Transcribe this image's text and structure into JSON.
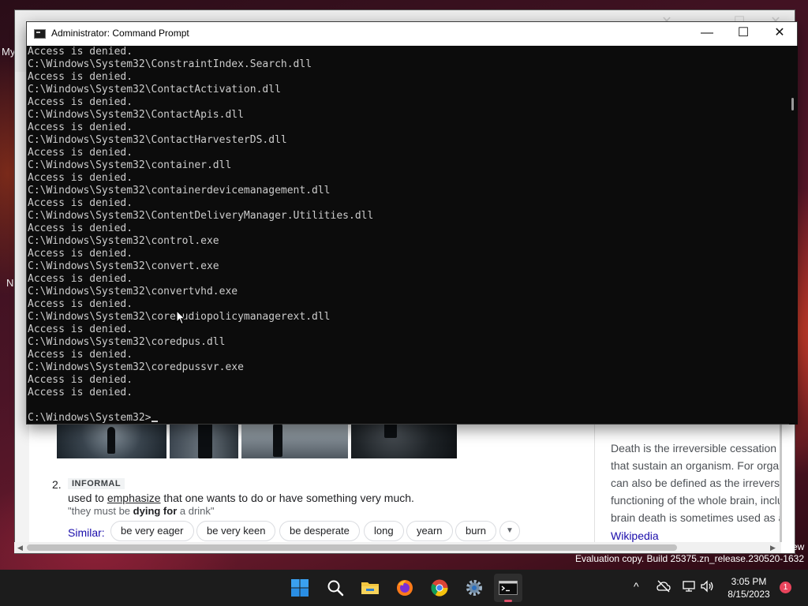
{
  "desktop": {
    "edge_labels": [
      "My",
      "N"
    ]
  },
  "browser": {
    "definition": {
      "number": "2.",
      "tag": "INFORMAL",
      "text_before": "used to ",
      "text_link": "emphasize",
      "text_after": " that one wants to do or have something very much.",
      "example_before": "\"they must be ",
      "example_bold": "dying for",
      "example_after": " a drink\"",
      "similar_label": "Similar:",
      "similar_chips": [
        "be very eager",
        "be very keen",
        "be desperate",
        "long",
        "yearn",
        "burn"
      ]
    },
    "knowledge_panel": {
      "lines": [
        "Death is the irreversible cessation",
        "that sustain an organism. For organ",
        "can also be defined as the irrevers",
        "functioning of the whole brain, inclu",
        "brain death is sometimes used as a"
      ],
      "source_link": "Wikipedia"
    },
    "edge_text": "ew"
  },
  "cmd": {
    "title": "Administrator: Command Prompt",
    "minimize_glyph": "—",
    "maximize_glyph": "☐",
    "close_glyph": "✕",
    "lines": [
      "Access is denied.",
      "C:\\Windows\\System32\\ConstraintIndex.Search.dll",
      "Access is denied.",
      "C:\\Windows\\System32\\ContactActivation.dll",
      "Access is denied.",
      "C:\\Windows\\System32\\ContactApis.dll",
      "Access is denied.",
      "C:\\Windows\\System32\\ContactHarvesterDS.dll",
      "Access is denied.",
      "C:\\Windows\\System32\\container.dll",
      "Access is denied.",
      "C:\\Windows\\System32\\containerdevicemanagement.dll",
      "Access is denied.",
      "C:\\Windows\\System32\\ContentDeliveryManager.Utilities.dll",
      "Access is denied.",
      "C:\\Windows\\System32\\control.exe",
      "Access is denied.",
      "C:\\Windows\\System32\\convert.exe",
      "Access is denied.",
      "C:\\Windows\\System32\\convertvhd.exe",
      "Access is denied.",
      "C:\\Windows\\System32\\coreaudiopolicymanagerext.dll",
      "Access is denied.",
      "C:\\Windows\\System32\\coredpus.dll",
      "Access is denied.",
      "C:\\Windows\\System32\\coredpussvr.exe",
      "Access is denied.",
      "Access is denied.",
      ""
    ],
    "prompt": "C:\\Windows\\System32>"
  },
  "watermark": "Evaluation copy. Build 25375.zn_release.230520-1632",
  "taskbar": {
    "apps": [
      {
        "name": "start-button",
        "icon": "windows-logo-icon"
      },
      {
        "name": "search-button",
        "icon": "search-icon"
      },
      {
        "name": "file-explorer-button",
        "icon": "folder-icon"
      },
      {
        "name": "firefox-button",
        "icon": "firefox-icon"
      },
      {
        "name": "chrome-button",
        "icon": "chrome-icon"
      },
      {
        "name": "settings-button",
        "icon": "gear-icon"
      },
      {
        "name": "terminal-button",
        "icon": "terminal-icon"
      }
    ],
    "tray": {
      "chevron": "^",
      "time": "3:05 PM",
      "date": "8/15/2023",
      "notification_count": "1"
    }
  },
  "colors": {
    "terminal_bg": "#0c0c0c",
    "terminal_text": "#cccccc",
    "taskbar_bg": "#1c1c1c",
    "accent_indicator": "#e0506a",
    "link": "#1a0dab"
  }
}
